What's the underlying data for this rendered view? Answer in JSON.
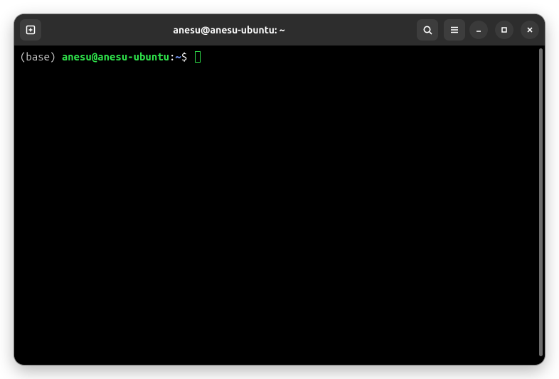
{
  "window": {
    "title": "anesu@anesu-ubuntu: ~"
  },
  "titlebar": {
    "new_tab_icon": "new-tab",
    "search_icon": "search",
    "menu_icon": "hamburger",
    "minimize_icon": "minimize",
    "maximize_icon": "maximize",
    "close_icon": "close"
  },
  "terminal": {
    "prompt_env": "(base) ",
    "prompt_userhost": "anesu@anesu-ubuntu",
    "prompt_colon": ":",
    "prompt_path": "~",
    "prompt_dollar": "$"
  }
}
